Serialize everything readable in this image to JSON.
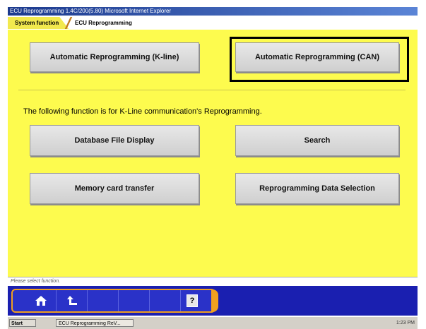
{
  "window": {
    "title": "ECU Reprogramming 1.4C/200(5.80)   Microsoft Internet Explorer"
  },
  "tabs": {
    "active": "System function",
    "current": "ECU Reprogramming"
  },
  "buttons": {
    "auto_kline": "Automatic Reprogramming (K-line)",
    "auto_can": "Automatic Reprogramming (CAN)",
    "database": "Database File Display",
    "search": "Search",
    "memory": "Memory card transfer",
    "repro_data": "Reprogramming Data Selection"
  },
  "info_text": "The following function is for K-Line communication's Reprogramming.",
  "status_text": "Please select function.",
  "toolbar": {
    "home_icon": "home-icon",
    "back_icon": "back-arrow-icon",
    "help_label": "?"
  },
  "taskbar": {
    "start_label": "Start",
    "task_label": "ECU Reprogramming ReV...",
    "clock": "1:23 PM"
  },
  "colors": {
    "content_bg": "#fdfb4e",
    "toolbar_bg": "#1a1fb0",
    "accent": "#f0a020"
  }
}
